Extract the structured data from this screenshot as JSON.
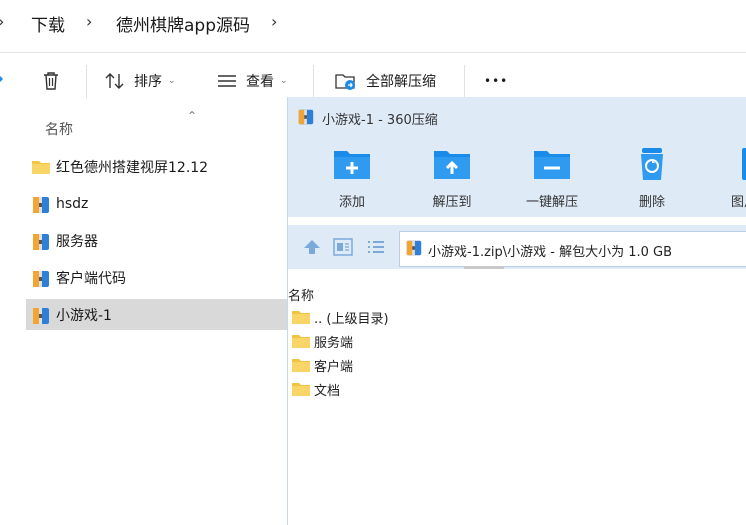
{
  "breadcrumb": {
    "sep_left": "›",
    "item1": "下载",
    "sep1": "›",
    "item2": "德州棋牌app源码",
    "sep2": "›"
  },
  "toolbar": {
    "sort_label": "排序",
    "view_label": "查看",
    "extract_all_label": "全部解压缩",
    "more_label": "•••"
  },
  "explorer_list": {
    "column_name": "名称",
    "items": [
      {
        "label": "红色德州搭建视屏12.12",
        "icon": "folder-icon"
      },
      {
        "label": "hsdz",
        "icon": "archive-icon"
      },
      {
        "label": "服务器",
        "icon": "archive-icon"
      },
      {
        "label": "客户端代码",
        "icon": "archive-icon"
      },
      {
        "label": "小游戏-1",
        "icon": "archive-icon",
        "selected": true
      }
    ]
  },
  "zip_window": {
    "title": "小游戏-1 - 360压缩",
    "tools": [
      {
        "label": "添加",
        "icon": "add-icon"
      },
      {
        "label": "解压到",
        "icon": "extract-to-icon"
      },
      {
        "label": "一键解压",
        "icon": "one-click-extract-icon"
      },
      {
        "label": "删除",
        "icon": "delete-icon"
      },
      {
        "label": "图片",
        "icon": "image-icon"
      }
    ],
    "address": "小游戏-1.zip\\小游戏 - 解包大小为 1.0 GB",
    "list_header": "名称",
    "entries": [
      {
        "label": ".. (上级目录)"
      },
      {
        "label": "服务端"
      },
      {
        "label": "客户端"
      },
      {
        "label": "文档"
      }
    ]
  },
  "colors": {
    "accent_blue": "#1a8be8",
    "folder_yellow": "#f3c343",
    "zip_panel_bg": "#dfeaf7",
    "selected_row": "#d9d9d9"
  }
}
